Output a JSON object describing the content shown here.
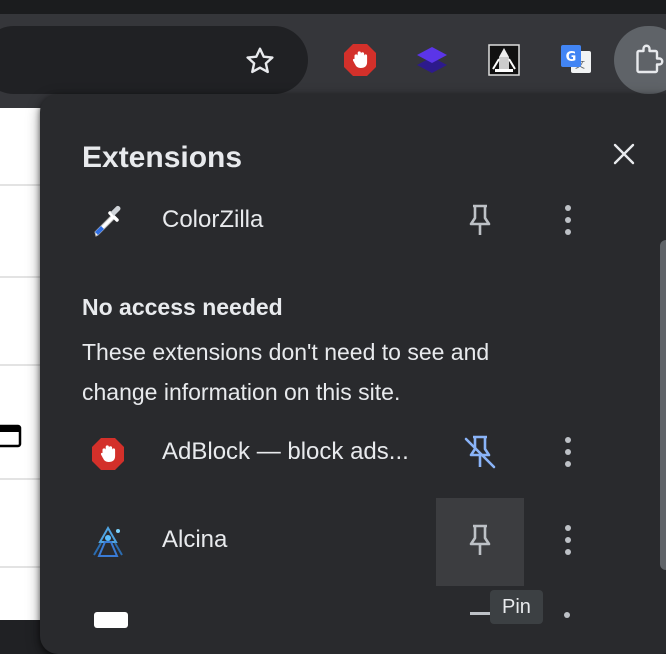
{
  "toolbar": {
    "bookmark_icon": "star-outline-icon",
    "pinned_extensions": [
      {
        "name": "adblock-icon",
        "color": "#d3302a"
      },
      {
        "name": "layers-icon",
        "color": "#4a2bd6"
      },
      {
        "name": "alcina-icon",
        "color": "#ffffff"
      },
      {
        "name": "google-translate-icon",
        "color": "#4285f4"
      }
    ],
    "extensions_button_icon": "puzzle-piece-icon"
  },
  "popup": {
    "title": "Extensions",
    "close_icon": "close-icon",
    "access_section": {
      "items": [
        {
          "name": "ColorZilla",
          "icon": "eyedropper-icon",
          "pinned": true
        }
      ]
    },
    "no_access_section": {
      "heading": "No access needed",
      "description": "These extensions don't need to see and change information on this site.",
      "items": [
        {
          "name": "AdBlock — block ads...",
          "icon": "adblock-icon",
          "pinned": false
        },
        {
          "name": "Alcina",
          "icon": "alcina-icon",
          "pinned": true
        }
      ]
    },
    "tooltip": "Pin"
  },
  "colors": {
    "popup_bg": "#292a2d",
    "text": "#e8eaed",
    "pin_unpinned": "#8ab4f8",
    "adblock_red": "#d3302a"
  }
}
